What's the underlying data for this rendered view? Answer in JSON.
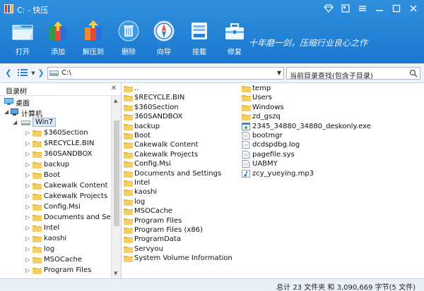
{
  "window": {
    "title": "C: - 快压"
  },
  "toolbar": {
    "buttons": [
      {
        "label": "打开",
        "icon": "open-folder-icon"
      },
      {
        "label": "添加",
        "icon": "add-archive-icon"
      },
      {
        "label": "解压到",
        "icon": "extract-icon"
      },
      {
        "label": "删除",
        "icon": "recycle-bin-icon"
      },
      {
        "label": "向导",
        "icon": "compass-icon"
      },
      {
        "label": "挂载",
        "icon": "drive-icon"
      },
      {
        "label": "修复",
        "icon": "toolbox-icon"
      }
    ],
    "slogan": "十年磨一剑，压缩行业良心之作"
  },
  "address": {
    "path": "C:\\",
    "search_placeholder": "当前目录查找(包含子目录)"
  },
  "tree": {
    "header": "目录树",
    "nodes": [
      {
        "label": "桌面",
        "level": 0
      },
      {
        "label": "计算机",
        "level": 1
      },
      {
        "label": "Win7",
        "level": 2,
        "selected": true
      },
      {
        "label": "$360Section",
        "level": 3
      },
      {
        "label": "$RECYCLE.BIN",
        "level": 3
      },
      {
        "label": "360SANDBOX",
        "level": 3
      },
      {
        "label": "backup",
        "level": 3
      },
      {
        "label": "Boot",
        "level": 3
      },
      {
        "label": "Cakewalk Content",
        "level": 3
      },
      {
        "label": "Cakewalk Projects",
        "level": 3
      },
      {
        "label": "Config.Msi",
        "level": 3
      },
      {
        "label": "Documents and Settings",
        "level": 3
      },
      {
        "label": "Intel",
        "level": 3
      },
      {
        "label": "kaoshi",
        "level": 3
      },
      {
        "label": "log",
        "level": 3
      },
      {
        "label": "MSOCache",
        "level": 3
      },
      {
        "label": "Program Files",
        "level": 3
      }
    ]
  },
  "files": {
    "col1": [
      {
        "name": "..",
        "type": "folder"
      },
      {
        "name": "$RECYCLE.BIN",
        "type": "folder"
      },
      {
        "name": "$360Section",
        "type": "folder"
      },
      {
        "name": "360SANDBOX",
        "type": "folder"
      },
      {
        "name": "backup",
        "type": "folder"
      },
      {
        "name": "Boot",
        "type": "folder"
      },
      {
        "name": "Cakewalk Content",
        "type": "folder"
      },
      {
        "name": "Cakewalk Projects",
        "type": "folder"
      },
      {
        "name": "Config.Msi",
        "type": "folder"
      },
      {
        "name": "Documents and Settings",
        "type": "folder"
      },
      {
        "name": "Intel",
        "type": "folder"
      },
      {
        "name": "kaoshi",
        "type": "folder"
      },
      {
        "name": "log",
        "type": "folder"
      },
      {
        "name": "MSOCache",
        "type": "folder"
      },
      {
        "name": "Program Files",
        "type": "folder"
      },
      {
        "name": "Program Files (x86)",
        "type": "folder"
      },
      {
        "name": "ProgramData",
        "type": "folder"
      },
      {
        "name": "Servyou",
        "type": "folder"
      },
      {
        "name": "System Volume Information",
        "type": "folder"
      }
    ],
    "col2": [
      {
        "name": "temp",
        "type": "folder"
      },
      {
        "name": "Users",
        "type": "folder"
      },
      {
        "name": "Windows",
        "type": "folder"
      },
      {
        "name": "zd_gszq",
        "type": "folder"
      },
      {
        "name": "2345_34880_34880_deskonly.exe",
        "type": "exe"
      },
      {
        "name": "bootmgr",
        "type": "file"
      },
      {
        "name": "dcdspdbg.log",
        "type": "file"
      },
      {
        "name": "pagefile.sys",
        "type": "file"
      },
      {
        "name": "UABMY",
        "type": "file"
      },
      {
        "name": "zcy_yueying.mp3",
        "type": "audio"
      }
    ]
  },
  "status": {
    "text": "总计 23 文件夹 和 3,090,669 字节(5 文件)"
  }
}
